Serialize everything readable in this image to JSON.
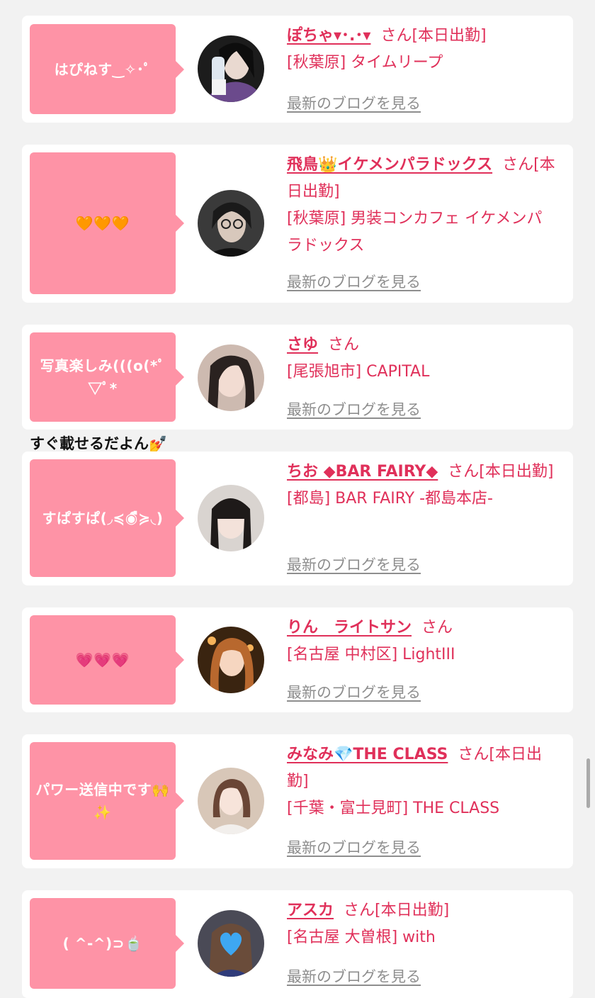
{
  "posts": [
    {
      "bubble": "はぴねす‿✧･ﾟ",
      "name": "ぽちゃ▾･.･▾",
      "suffix": "さん[本日出勤]",
      "shop": "[秋葉原] タイムリープ",
      "blog": "最新のブログを見る"
    },
    {
      "bubble": "🧡🧡🧡",
      "name": "飛鳥👑イケメンパラドックス",
      "suffix": "さん[本日出勤]",
      "shop": "[秋葉原] 男装コンカフェ イケメンパラドックス",
      "blog": "最新のブログを見る"
    },
    {
      "bubble": "写真楽しみ(((o(*ﾟ▽ﾟ*",
      "name": "さゆ",
      "suffix": "さん",
      "shop": "[尾張旭市] CAPITAL",
      "blog": "最新のブログを見る"
    },
    {
      "bubble": "すぱすぱ(◞≼◉ื≽◟)",
      "name": "ちお ◆BAR FAIRY◆",
      "suffix": "さん[本日出勤]",
      "shop": "[都島] BAR FAIRY -都島本店-",
      "blog": "最新のブログを見る"
    },
    {
      "bubble": "💗💗💗",
      "name": "りん　ライトサン",
      "suffix": "さん",
      "shop": "[名古屋 中村区] LightIII",
      "blog": "最新のブログを見る"
    },
    {
      "bubble": "パワー送信中です🙌✨",
      "name": "みなみ💎THE CLASS",
      "suffix": "さん[本日出勤]",
      "shop": "[千葉・富士見町] THE CLASS",
      "blog": "最新のブログを見る"
    },
    {
      "bubble": "( ^-^)⊃🍵",
      "name": "アスカ",
      "suffix": "さん[本日出勤]",
      "shop": "[名古屋 大曽根] with",
      "blog": "最新のブログを見る"
    }
  ],
  "overlay_text": "すぐ載せるだよん💅"
}
